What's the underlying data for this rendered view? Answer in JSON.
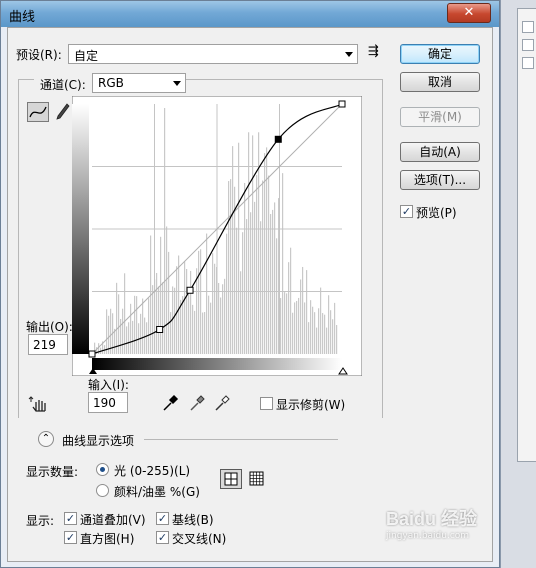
{
  "window": {
    "title": "曲线",
    "close_glyph": "✕"
  },
  "preset": {
    "label": "预设(R):",
    "value": "自定",
    "menu_glyph": "⇶"
  },
  "channel": {
    "label": "通道(C):",
    "value": "RGB"
  },
  "buttons": {
    "ok": "确定",
    "cancel": "取消",
    "smooth": "平滑(M)",
    "auto": "自动(A)",
    "options": "选项(T)..."
  },
  "preview": {
    "label": "预览(P)",
    "checked": true
  },
  "output": {
    "label": "输出(O):",
    "value": "219"
  },
  "input": {
    "label": "输入(I):",
    "value": "190"
  },
  "show_clipping": {
    "label": "显示修剪(W)",
    "checked": false
  },
  "curve_options": {
    "label": "曲线显示选项",
    "expand_glyph": "⌃"
  },
  "show_amount": {
    "label": "显示数量:",
    "options": [
      {
        "label": "光 (0-255)(L)",
        "selected": true
      },
      {
        "label": "颜料/油墨 %(G)",
        "selected": false
      }
    ]
  },
  "display": {
    "label": "显示:",
    "items": [
      {
        "label": "通道叠加(V)",
        "checked": true
      },
      {
        "label": "基线(B)",
        "checked": true
      },
      {
        "label": "直方图(H)",
        "checked": true
      },
      {
        "label": "交叉线(N)",
        "checked": true
      }
    ]
  },
  "watermark": {
    "text": "Baidu 经验",
    "sub": "jingyan.baidu.com"
  },
  "colors": {
    "curve": "#000000",
    "histogram": "#c9c9c9",
    "grid": "#c4c4c4"
  }
}
